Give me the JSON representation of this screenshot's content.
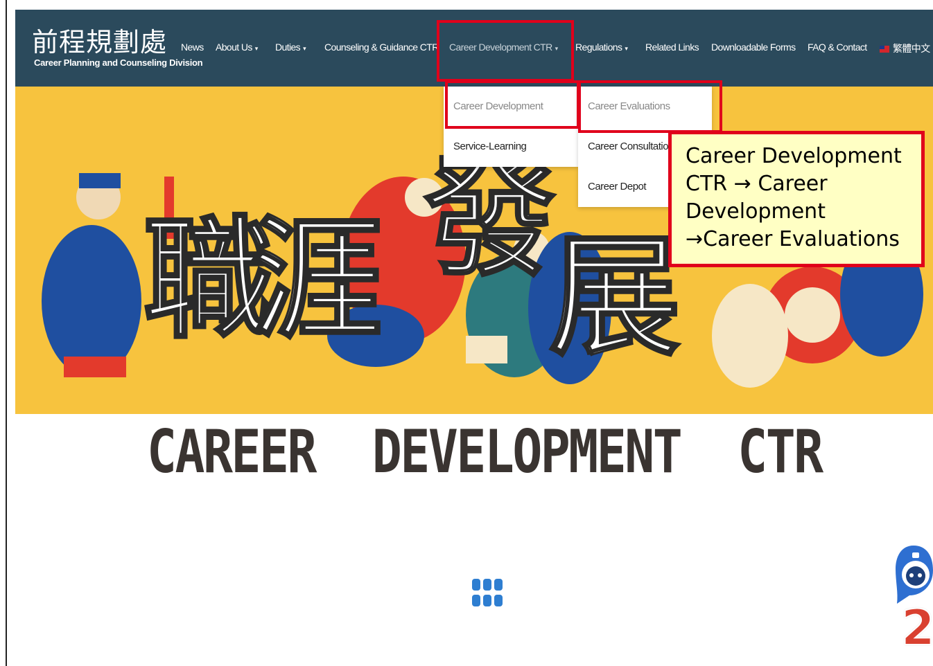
{
  "header": {
    "logo_zh": "前程規劃處",
    "logo_en": "Career Planning and Counseling Division"
  },
  "nav": {
    "news": "News",
    "about": "About Us",
    "duties": "Duties",
    "counseling": "Counseling & Guidance CTR",
    "career_ctr": "Career Development CTR",
    "regulations": "Regulations",
    "related_links": "Related Links",
    "forms": "Downloadable Forms",
    "faq": "FAQ & Contact",
    "language": "繁體中文"
  },
  "dropdown": {
    "col1": [
      "Career Development",
      "Service-Learning"
    ],
    "col2": [
      "Career Evaluations",
      "Career Consultation",
      "Career Depot"
    ]
  },
  "hero": {
    "chars": [
      "職",
      "涯",
      "發",
      "展"
    ]
  },
  "page_title": "CAREER DEVELOPMENT CTR",
  "callout": "Career Development CTR → Career Development →Career Evaluations",
  "step_number": "2",
  "icons": {
    "grid": "grid-menu-icon",
    "bot": "chatbot-icon",
    "caret": "chevron-down-icon",
    "flag": "taiwan-flag-icon"
  },
  "colors": {
    "nav_bg": "#2b4a5c",
    "hero_bg": "#f7c33e",
    "highlight": "#e0001b",
    "callout_bg": "#ffffc4",
    "title": "#3a3431",
    "grid_icon": "#2e7ed1"
  }
}
